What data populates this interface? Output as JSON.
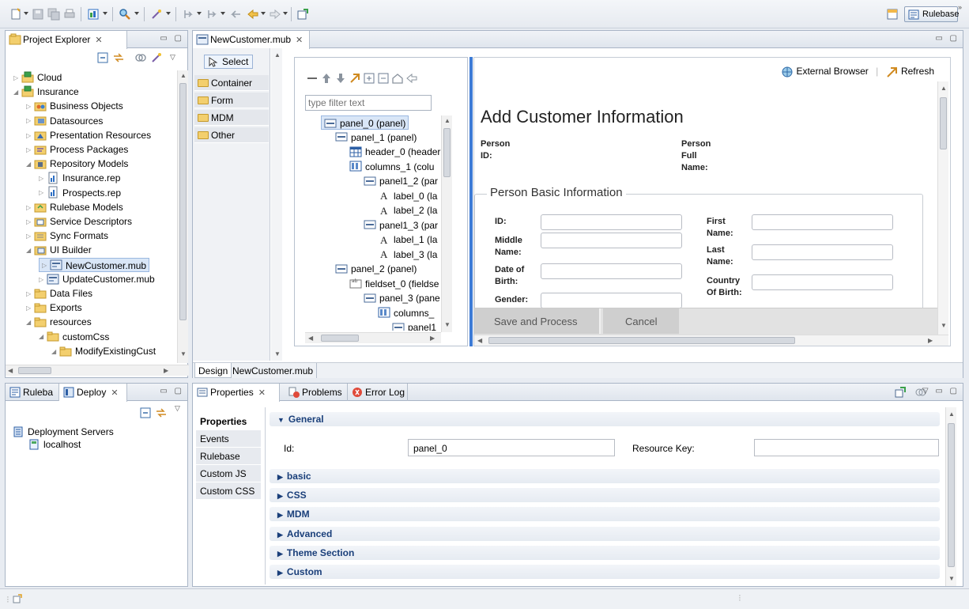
{
  "perspective": {
    "label": "Rulebase"
  },
  "explorer": {
    "tab": "Project Explorer",
    "items": [
      {
        "label": "Cloud",
        "level": 0,
        "icon": "project-icon"
      },
      {
        "label": "Insurance",
        "level": 0,
        "icon": "project-icon"
      },
      {
        "label": "Business Objects",
        "level": 1,
        "icon": "business-objects-icon"
      },
      {
        "label": "Datasources",
        "level": 1,
        "icon": "datasource-icon"
      },
      {
        "label": "Presentation Resources",
        "level": 1,
        "icon": "presentation-icon"
      },
      {
        "label": "Process Packages",
        "level": 1,
        "icon": "process-icon"
      },
      {
        "label": "Repository Models",
        "level": 1,
        "icon": "repository-icon"
      },
      {
        "label": "Insurance.rep",
        "level": 2,
        "icon": "rep-file-icon"
      },
      {
        "label": "Prospects.rep",
        "level": 2,
        "icon": "rep-file-icon"
      },
      {
        "label": "Rulebase Models",
        "level": 1,
        "icon": "rulebase-folder-icon"
      },
      {
        "label": "Service Descriptors",
        "level": 1,
        "icon": "service-icon"
      },
      {
        "label": "Sync Formats",
        "level": 1,
        "icon": "sync-icon"
      },
      {
        "label": "UI Builder",
        "level": 1,
        "icon": "ui-builder-icon"
      },
      {
        "label": "NewCustomer.mub",
        "level": 2,
        "icon": "mub-file-icon"
      },
      {
        "label": "UpdateCustomer.mub",
        "level": 2,
        "icon": "mub-file-icon"
      },
      {
        "label": "Data Files",
        "level": 1,
        "icon": "folder-icon"
      },
      {
        "label": "Exports",
        "level": 1,
        "icon": "folder-icon"
      },
      {
        "label": "resources",
        "level": 1,
        "icon": "folder-icon"
      },
      {
        "label": "customCss",
        "level": 2,
        "icon": "folder-icon"
      },
      {
        "label": "ModifyExistingCust",
        "level": 3,
        "icon": "folder-icon"
      }
    ]
  },
  "deploy": {
    "tabs": [
      "Ruleba",
      "Deploy"
    ],
    "items": [
      {
        "label": "Deployment Servers",
        "level": 0
      },
      {
        "label": "localhost",
        "level": 1
      }
    ]
  },
  "editor": {
    "tab": "NewCustomer.mub",
    "bottom_tabs": [
      "Design",
      "NewCustomer.mub"
    ],
    "palette": {
      "select": "Select",
      "items": [
        "Container",
        "Form",
        "MDM",
        "Other"
      ]
    },
    "outline": {
      "filter_placeholder": "type filter text",
      "items": [
        {
          "label": "panel_0 (panel)",
          "level": 0,
          "icon": "panel-icon"
        },
        {
          "label": "panel_1 (panel)",
          "level": 1,
          "icon": "panel-icon"
        },
        {
          "label": "header_0 (header",
          "level": 2,
          "icon": "header-icon"
        },
        {
          "label": "columns_1 (colu",
          "level": 2,
          "icon": "columns-icon"
        },
        {
          "label": "panel1_2 (par",
          "level": 3,
          "icon": "panel-icon"
        },
        {
          "label": "label_0 (la",
          "level": 4,
          "icon": "label-icon"
        },
        {
          "label": "label_2 (la",
          "level": 4,
          "icon": "label-icon"
        },
        {
          "label": "panel1_3 (par",
          "level": 3,
          "icon": "panel-icon"
        },
        {
          "label": "label_1 (la",
          "level": 4,
          "icon": "label-icon"
        },
        {
          "label": "label_3 (la",
          "level": 4,
          "icon": "label-icon"
        },
        {
          "label": "panel_2 (panel)",
          "level": 1,
          "icon": "panel-icon"
        },
        {
          "label": "fieldset_0 (fieldse",
          "level": 2,
          "icon": "fieldset-icon"
        },
        {
          "label": "panel_3 (pane",
          "level": 3,
          "icon": "panel-icon"
        },
        {
          "label": "columns_",
          "level": 4,
          "icon": "columns-icon"
        },
        {
          "label": "panel1",
          "level": 5,
          "icon": "panel-icon"
        }
      ]
    },
    "preview": {
      "external_browser": "External Browser",
      "refresh": "Refresh",
      "title": "Add Customer Information",
      "person_id": "Person\nID:",
      "person_full_name": "Person\nFull\nName:",
      "fieldset_legend": "Person Basic Information",
      "fields_left": [
        "ID:",
        "Middle\nName:",
        "Date of\nBirth:",
        "Gender:"
      ],
      "fields_right": [
        "First\nName:",
        "Last\nName:",
        "Country\nOf Birth:"
      ],
      "save_button": "Save and Process",
      "cancel_button": "Cancel"
    }
  },
  "properties": {
    "tabs": [
      "Properties",
      "Problems",
      "Error Log"
    ],
    "side_tabs": [
      "Properties",
      "Events",
      "Rulebase",
      "Custom JS",
      "Custom CSS"
    ],
    "general": "General",
    "id_label": "Id:",
    "id_value": "panel_0",
    "resource_key_label": "Resource Key:",
    "sections": [
      "basic",
      "CSS",
      "MDM",
      "Advanced",
      "Theme Section",
      "Custom"
    ]
  },
  "colors": {
    "accent": "#2a5db0",
    "selection": "#d9e6f7",
    "chrome": "#dfe5ed"
  }
}
